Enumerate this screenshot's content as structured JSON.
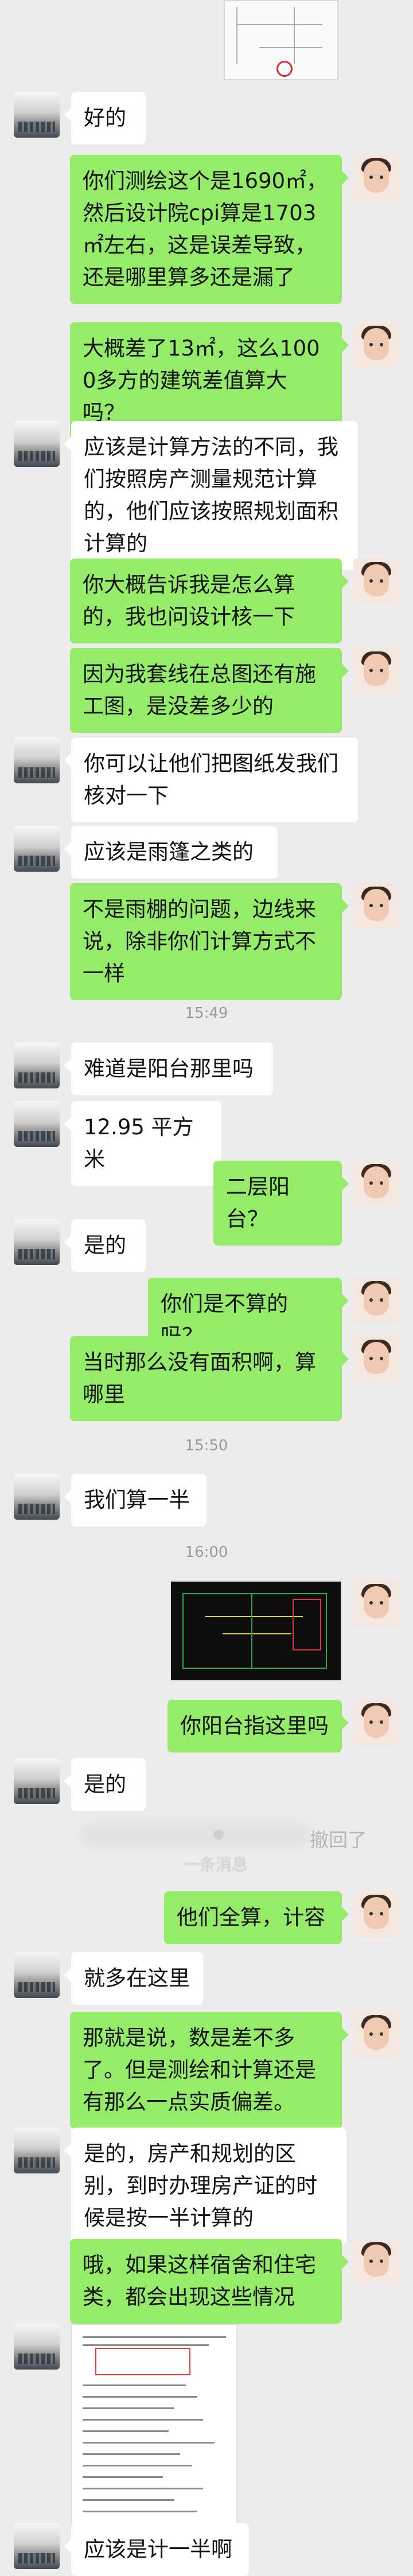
{
  "messages": [
    {
      "side": "left",
      "text": "好的"
    },
    {
      "side": "right",
      "text": "你们测绘这个是1690㎡，然后设计院cpi算是1703㎡左右，这是误差导致，还是哪里算多还是漏了"
    },
    {
      "side": "right",
      "text": "大概差了13㎡，这么1000多方的建筑差值算大吗？"
    },
    {
      "side": "left",
      "text": "应该是计算方法的不同，我们按照房产测量规范计算的，他们应该按照规划面积计算的"
    },
    {
      "side": "right",
      "text": "你大概告诉我是怎么算的，我也问设计核一下"
    },
    {
      "side": "right",
      "text": "因为我套线在总图还有施工图，是没差多少的"
    },
    {
      "side": "left",
      "text": "你可以让他们把图纸发我们核对一下"
    },
    {
      "side": "left",
      "text": "应该是雨篷之类的"
    },
    {
      "side": "right",
      "text": "不是雨棚的问题，边线来说，除非你们计算方式不一样"
    },
    {
      "time": "15:49"
    },
    {
      "side": "left",
      "text": "难道是阳台那里吗"
    },
    {
      "side": "left",
      "text": "12.95 平方米"
    },
    {
      "side": "right",
      "text": "二层阳台？"
    },
    {
      "side": "left",
      "text": "是的"
    },
    {
      "side": "right",
      "text": "你们是不算的吗？"
    },
    {
      "side": "right",
      "text": "当时那么没有面积啊，算哪里"
    },
    {
      "time": "15:50"
    },
    {
      "side": "left",
      "text": "我们算一半"
    },
    {
      "time": "16:00"
    },
    {
      "side": "right",
      "image": "cad-drawing-image"
    },
    {
      "side": "right",
      "text": "你阳台指这里吗"
    },
    {
      "side": "left",
      "text": "是的"
    },
    {
      "recall": "撤回了",
      "recall_msg": "一条消息"
    },
    {
      "side": "right",
      "text": "他们全算，计容"
    },
    {
      "side": "left",
      "text": "就多在这里"
    },
    {
      "side": "right",
      "text": "那就是说，数是差不多了。但是测绘和计算还是有那么一点实质偏差。"
    },
    {
      "side": "left",
      "text": "是的，房产和规划的区别，到时办理房产证的时候是按一半计算的"
    },
    {
      "side": "right",
      "text": "哦，如果这样宿舍和住宅类，都会出现这些情况"
    },
    {
      "side": "left",
      "image": "document-image"
    },
    {
      "side": "left",
      "text": "应该是计一半啊"
    }
  ]
}
